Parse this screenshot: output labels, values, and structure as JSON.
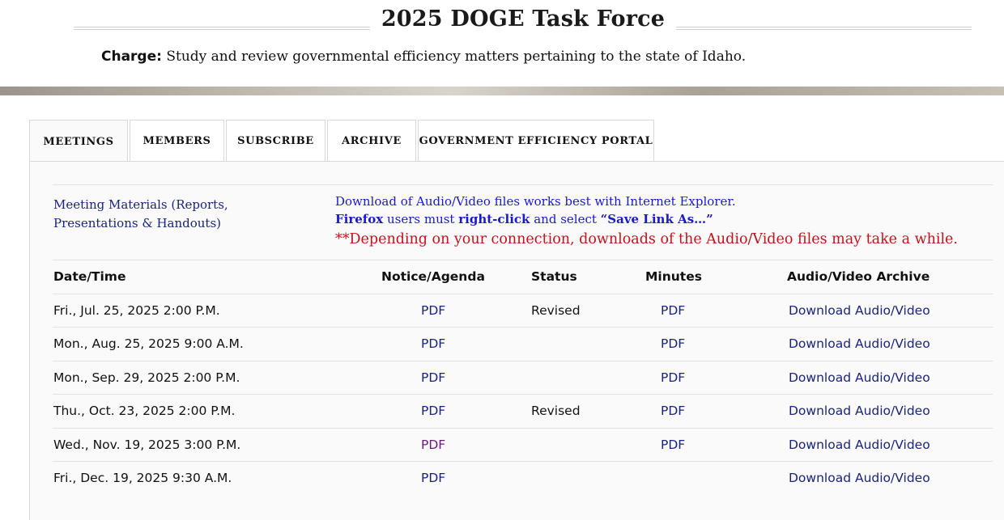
{
  "page": {
    "title": "2025 DOGE Task Force",
    "charge_label": "Charge:",
    "charge_text": " Study and review governmental efficiency matters pertaining to the state of Idaho."
  },
  "tabs": [
    "MEETINGS",
    "MEMBERS",
    "SUBSCRIBE",
    "ARCHIVE",
    "GOVERNMENT EFFICIENCY PORTAL"
  ],
  "active_tab": "MEETINGS",
  "materials_link": "Meeting Materials (Reports, Presentations & Handouts)",
  "notes": {
    "line1": "Download of Audio/Video files works best with Internet Explorer.",
    "firefox": "Firefox",
    "users_must": " users must ",
    "right_click": "right-click",
    "and_select": " and select ",
    "save_link": "“Save Link As…”",
    "warning": "**Depending on your connection, downloads of the Audio/Video files may take a while."
  },
  "table": {
    "headers": {
      "datetime": "Date/Time",
      "notice": "Notice/Agenda",
      "status": "Status",
      "minutes": "Minutes",
      "av": "Audio/Video Archive"
    },
    "rows": [
      {
        "datetime": "Fri., Jul. 25, 2025 2:00 P.M.",
        "notice": "PDF",
        "status": "Revised",
        "minutes": "PDF",
        "av": "Download Audio/Video"
      },
      {
        "datetime": "Mon., Aug. 25, 2025 9:00 A.M.",
        "notice": "PDF",
        "status": "",
        "minutes": "PDF",
        "av": "Download Audio/Video"
      },
      {
        "datetime": "Mon., Sep. 29, 2025 2:00 P.M.",
        "notice": "PDF",
        "status": "",
        "minutes": "PDF",
        "av": "Download Audio/Video"
      },
      {
        "datetime": "Thu., Oct. 23, 2025 2:00 P.M.",
        "notice": "PDF",
        "status": "Revised",
        "minutes": "PDF",
        "av": "Download Audio/Video"
      },
      {
        "datetime": "Wed., Nov. 19, 2025 3:00 P.M.",
        "notice": "PDF",
        "status": "",
        "minutes": "PDF",
        "av": "Download Audio/Video"
      },
      {
        "datetime": "Fri., Dec. 19, 2025 9:30 A.M.",
        "notice": "PDF",
        "status": "",
        "minutes": "",
        "av": "Download Audio/Video"
      }
    ]
  },
  "colors": {
    "link": "#1a237e",
    "visited_link": "#6a1b7a",
    "note_link": "#1a1acc",
    "warning": "#c0141c"
  }
}
